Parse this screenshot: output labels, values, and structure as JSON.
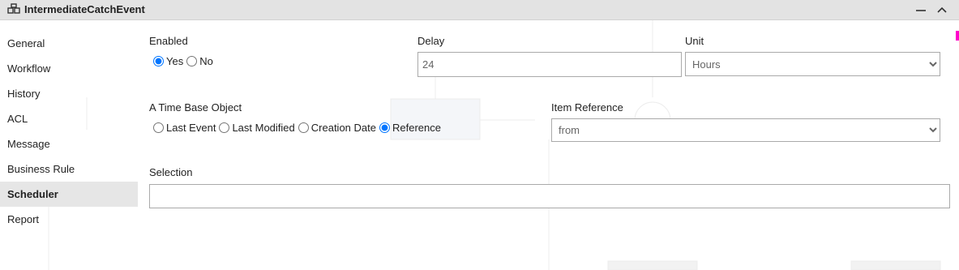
{
  "window": {
    "title": "IntermediateCatchEvent",
    "icon": "diagram-node-icon",
    "controls": [
      "minimize-icon",
      "collapse-icon"
    ]
  },
  "sidebar": {
    "items": [
      {
        "label": "General",
        "active": false
      },
      {
        "label": "Workflow",
        "active": false
      },
      {
        "label": "History",
        "active": false
      },
      {
        "label": "ACL",
        "active": false
      },
      {
        "label": "Message",
        "active": false
      },
      {
        "label": "Business Rule",
        "active": false
      },
      {
        "label": "Scheduler",
        "active": true
      },
      {
        "label": "Report",
        "active": false
      }
    ]
  },
  "form": {
    "enabled": {
      "label": "Enabled",
      "options": [
        {
          "label": "Yes",
          "checked": true
        },
        {
          "label": "No",
          "checked": false
        }
      ]
    },
    "delay": {
      "label": "Delay",
      "value": "24"
    },
    "unit": {
      "label": "Unit",
      "selected": "Hours"
    },
    "time_base": {
      "label": "A Time Base Object",
      "options": [
        {
          "label": "Last Event",
          "checked": false
        },
        {
          "label": "Last Modified",
          "checked": false
        },
        {
          "label": "Creation Date",
          "checked": false
        },
        {
          "label": "Reference",
          "checked": true
        }
      ]
    },
    "item_reference": {
      "label": "Item Reference",
      "selected": "from"
    },
    "selection": {
      "label": "Selection",
      "value": ""
    }
  },
  "colors": {
    "titlebar_bg": "#e3e3e3",
    "active_item_bg": "#e6e6e6",
    "radio_accent": "#1a73e8",
    "edge_accent": "#ff00cc"
  }
}
